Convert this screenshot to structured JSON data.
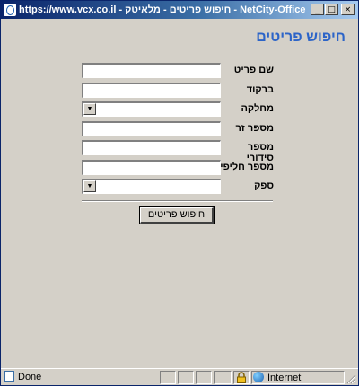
{
  "window": {
    "title": "https://www.vcx.co.il - חיפוש פריטים - מלאיטק - NetCity-Office - Microsoft I...",
    "minimize_glyph": "_",
    "maximize_glyph": "□",
    "close_glyph": "×"
  },
  "page": {
    "title": "חיפוש פריטים"
  },
  "form": {
    "fields": [
      {
        "label": "שם פריט",
        "value": ""
      },
      {
        "label": "ברקוד",
        "value": ""
      },
      {
        "label": "מחלקה",
        "value": ""
      },
      {
        "label": "מספר זר",
        "value": ""
      },
      {
        "label": "מספר סידורי",
        "value": ""
      },
      {
        "label": "מספר חליפי",
        "value": ""
      },
      {
        "label": "ספק",
        "value": ""
      }
    ],
    "dropdown_glyph": "▼",
    "search_button": "חיפוש פריטים"
  },
  "statusbar": {
    "status": "Done",
    "zone": "Internet"
  },
  "colors": {
    "title_accent": "#2c64c8",
    "titlebar": "#0a246a",
    "face": "#d4d0c8"
  }
}
